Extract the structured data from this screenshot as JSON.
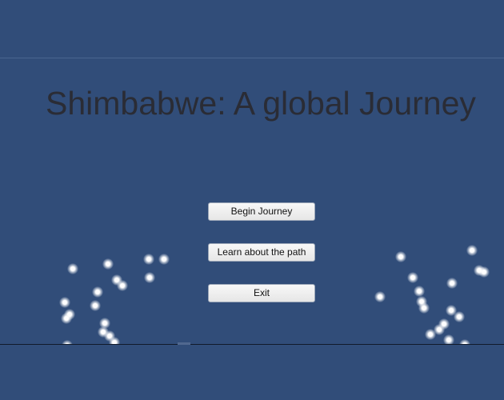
{
  "title": "Shimbabwe: A global Journey",
  "menu": {
    "begin_label": "Begin Journey",
    "learn_label": "Learn about the path",
    "exit_label": "Exit"
  },
  "colors": {
    "background": "#314d79",
    "title_text": "#2a2c35",
    "button_face": "#f1f1f1"
  }
}
